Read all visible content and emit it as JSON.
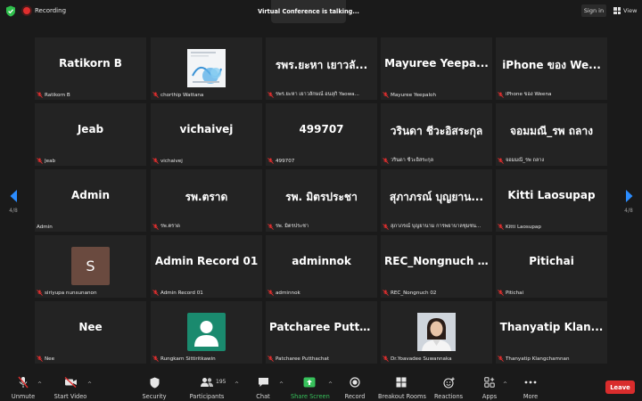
{
  "topbar": {
    "recording_label": "Recording",
    "speaking_banner": "Virtual Conference is talking...",
    "signin_label": "Sign in",
    "view_label": "View"
  },
  "pager": {
    "left_page": "4/8",
    "right_page": "4/8"
  },
  "tiles": [
    {
      "name": "Ratikorn B",
      "label": "Ratikorn B"
    },
    {
      "name": "",
      "label": "chorthip Wattana"
    },
    {
      "name": "รพร.ยะหา เยาวลั...",
      "label": "รพร.ยะหา เยาวลักษณ์ อนลุกิ Yaowa..."
    },
    {
      "name": "Mayuree Yeepa...",
      "label": "Mayuree Yeepaloh"
    },
    {
      "name": "iPhone ของ We...",
      "label": "iPhone ของ Weena"
    },
    {
      "name": "Jeab",
      "label": "Jeab"
    },
    {
      "name": "vichaivej",
      "label": "vichaivej"
    },
    {
      "name": "499707",
      "label": "499707"
    },
    {
      "name": "วรินดา ชีวะอิสระกุล",
      "label": "วรินดา ชีวะอิสระกุล"
    },
    {
      "name": "จอมมณี_รพ ถลาง",
      "label": "จอมมณี_รพ ถลาง"
    },
    {
      "name": "Admin",
      "label": "Admin"
    },
    {
      "name": "รพ.ตราด",
      "label": "รพ.ตราด"
    },
    {
      "name": "รพ. มิตรประชา",
      "label": "รพ. มิตรประชา"
    },
    {
      "name": "สุภาภรณ์ บุญยาน...",
      "label": "สุภาภรณ์ บุญยานาม การพยาบาลชุมชน..."
    },
    {
      "name": "Kitti Laosupap",
      "label": "Kitti Laosupap"
    },
    {
      "name": "S",
      "label": "siriyupa nunsunanon"
    },
    {
      "name": "Admin Record 01",
      "label": "Admin Record 01"
    },
    {
      "name": "adminnok",
      "label": "adminnok"
    },
    {
      "name": "REC_Nongnuch ...",
      "label": "REC_Nongnuch 02"
    },
    {
      "name": "Pitichai",
      "label": "Pitichai"
    },
    {
      "name": "Nee",
      "label": "Nee"
    },
    {
      "name": "",
      "label": "Rungkarn Sittiritkawin"
    },
    {
      "name": "Patcharee Putth...",
      "label": "Patcharee Putthachat"
    },
    {
      "name": "",
      "label": "Dr.Yoavadee Suwannaka"
    },
    {
      "name": "Thanyatip Klan...",
      "label": "Thanyatip Klangchamnan"
    }
  ],
  "toolbar": {
    "unmute": "Unmute",
    "start_video": "Start Video",
    "security": "Security",
    "participants": "Participants",
    "participant_count": "195",
    "chat": "Chat",
    "share_screen": "Share Screen",
    "record": "Record",
    "breakout_rooms": "Breakout Rooms",
    "reactions": "Reactions",
    "apps": "Apps",
    "more": "More",
    "leave": "Leave"
  },
  "colors": {
    "accent_green": "#37c15b",
    "leave_red": "#d92c2c",
    "mute_red": "#e02e2e"
  }
}
